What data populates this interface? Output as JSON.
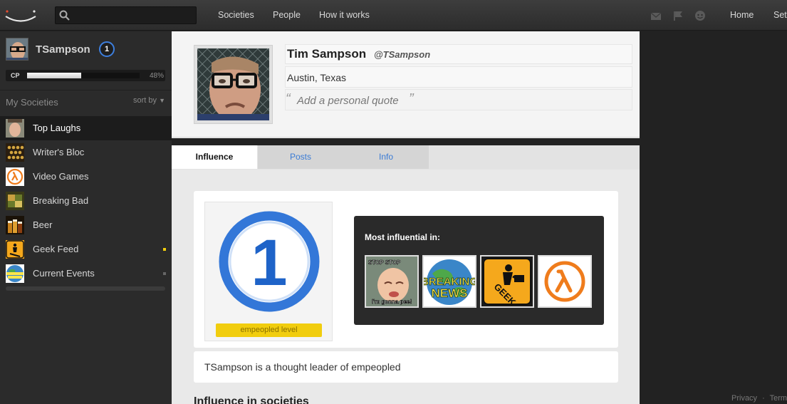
{
  "topbar": {
    "search_placeholder": "",
    "nav": [
      "Societies",
      "People",
      "How it works"
    ],
    "right_nav": [
      "Home",
      "Set"
    ]
  },
  "sidebar": {
    "username": "TSampson",
    "level": "1",
    "cp_label": "CP",
    "cp_percent_text": "48%",
    "cp_fraction": 0.48,
    "societies_title": "My Societies",
    "sort_label": "sort by",
    "societies": [
      {
        "label": "Top Laughs",
        "icon": "face-photo-thumb",
        "active": true,
        "dot": ""
      },
      {
        "label": "Writer's Bloc",
        "icon": "typewriter-thumb",
        "active": false,
        "dot": ""
      },
      {
        "label": "Video Games",
        "icon": "lambda-logo-thumb",
        "active": false,
        "dot": ""
      },
      {
        "label": "Breaking Bad",
        "icon": "breaking-bad-thumb",
        "active": false,
        "dot": ""
      },
      {
        "label": "Beer",
        "icon": "beer-thumb",
        "active": false,
        "dot": ""
      },
      {
        "label": "Geek Feed",
        "icon": "geek-sign-thumb",
        "active": false,
        "dot": "#f1cd0e"
      },
      {
        "label": "Current Events",
        "icon": "breaking-news-thumb",
        "active": false,
        "dot": "#666666"
      }
    ]
  },
  "profile": {
    "full_name": "Tim Sampson",
    "handle": "@TSampson",
    "location": "Austin, Texas",
    "quote_open": "“",
    "quote_placeholder": "Add a personal quote",
    "quote_close": "”"
  },
  "tabs": [
    {
      "label": "Influence",
      "active": true
    },
    {
      "label": "Posts",
      "active": false
    },
    {
      "label": "Info",
      "active": false
    }
  ],
  "influence": {
    "level_number": "1",
    "level_label": "empeopled level",
    "most_title": "Most influential in:",
    "most_thumbs": [
      "stop-stop-baby-thumb",
      "breaking-news-thumb",
      "geek-sign-thumb",
      "lambda-logo-thumb"
    ],
    "stop_caption_top": "STOP STOP",
    "stop_caption_bottom": "I'm gonna pee!",
    "breaking_line1": "BREAKING",
    "breaking_line2": "NEWS",
    "geek_text": "GEEK",
    "leader_text": "TSampson is a thought leader of empeopled",
    "section_title": "Influence in societies"
  },
  "footer": {
    "privacy": "Privacy",
    "sep": "·",
    "terms": "Term"
  },
  "colors": {
    "accent_blue": "#3d7fde",
    "level_yellow": "#f1cd0e",
    "link_blue": "#3a7bd5"
  }
}
